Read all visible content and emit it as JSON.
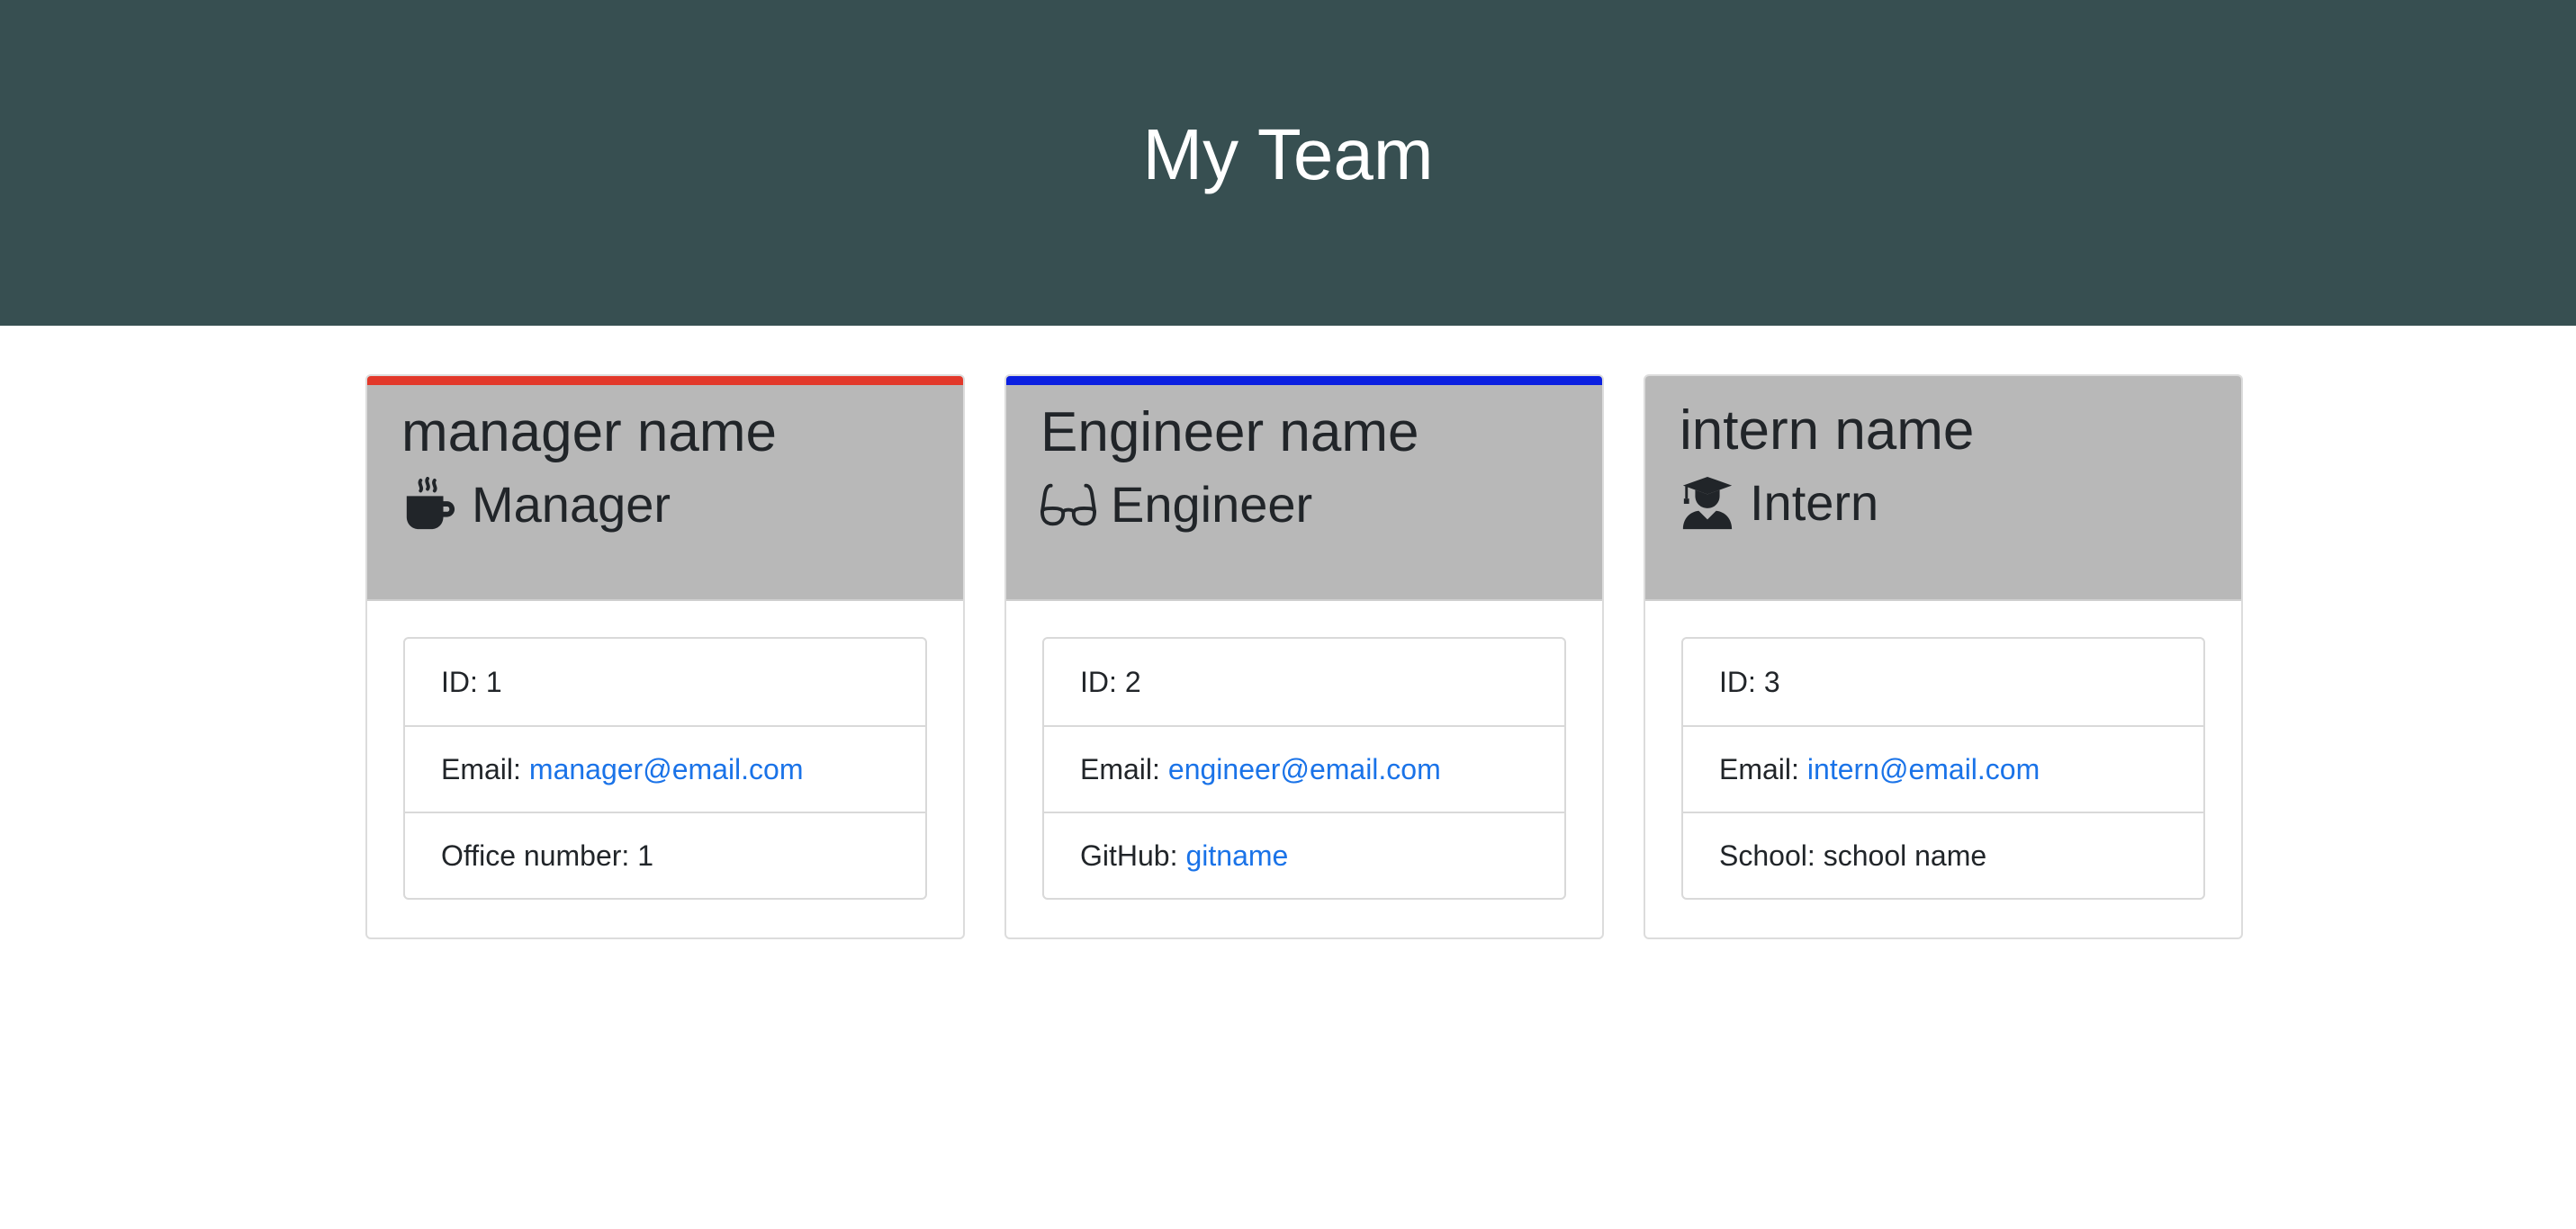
{
  "header": {
    "title": "My Team"
  },
  "cards": [
    {
      "name": "manager name",
      "role": "Manager",
      "icon": "coffee-mug-icon",
      "accent": "#e2382a",
      "id_label": "ID:",
      "id_value": "1",
      "email_label": "Email:",
      "email": "manager@email.com",
      "extra_label": "Office number:",
      "extra_value": "1"
    },
    {
      "name": "Engineer name",
      "role": "Engineer",
      "icon": "glasses-icon",
      "accent": "#0b1fe0",
      "id_label": "ID:",
      "id_value": "2",
      "email_label": "Email:",
      "email": "engineer@email.com",
      "extra_label": "GitHub:",
      "extra_value": "gitname"
    },
    {
      "name": "intern name",
      "role": "Intern",
      "icon": "graduate-icon",
      "accent": "",
      "id_label": "ID:",
      "id_value": "3",
      "email_label": "Email:",
      "email": "intern@email.com",
      "extra_label": "School:",
      "extra_value": "school name"
    }
  ]
}
